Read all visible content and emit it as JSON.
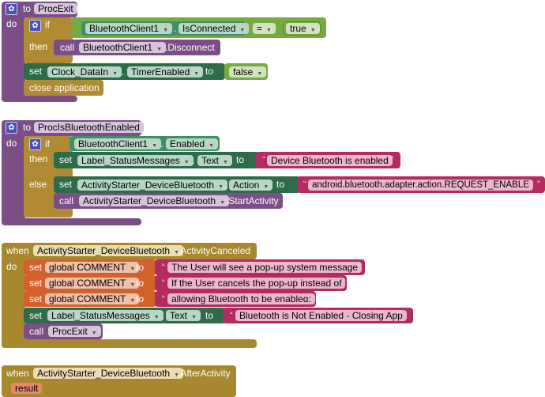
{
  "proc_exit": {
    "to": "to",
    "name": "ProcExit",
    "do": "do",
    "if": "if",
    "then": "then",
    "component": "BluetoothClient1",
    "property": "IsConnected",
    "op": "=",
    "true": "true",
    "call": "call",
    "call_component": "BluetoothClient1",
    "method": ".Disconnect",
    "set": "set",
    "set_component": "Clock_DataIn",
    "set_property": "TimerEnabled",
    "to_kw": "to",
    "false": "false",
    "close": "close application",
    "dot": "."
  },
  "proc_bt": {
    "to": "to",
    "name": "ProcIsBluetoothEnabled",
    "do": "do",
    "if": "if",
    "then": "then",
    "else": "else",
    "component": "BluetoothClient1",
    "property": "Enabled",
    "set": "set",
    "label": "Label_StatusMessages",
    "text_prop": "Text",
    "to_kw": "to",
    "msg": "Device Bluetooth is enabled",
    "starter": "ActivityStarter_DeviceBluetooth",
    "action": "Action",
    "action_value": "android.bluetooth.adapter.action.REQUEST_ENABLE",
    "call": "call",
    "method": ".StartActivity",
    "dot": "."
  },
  "event_cancel": {
    "when": "when",
    "component": "ActivityStarter_DeviceBluetooth",
    "event": ".ActivityCanceled",
    "do": "do",
    "set": "set",
    "var": "global COMMENT",
    "to_kw": "to",
    "comments": [
      "The User will see a pop-up system message",
      "If the User cancels the pop-up instead of",
      "allowing Bluetooth to be enabled:"
    ],
    "label": "Label_StatusMessages",
    "text_prop": "Text",
    "msg": "Bluetooth is Not Enabled - Closing App",
    "call": "call",
    "proc": "ProcExit",
    "dot": "."
  },
  "event_after": {
    "when": "when",
    "component": "ActivityStarter_DeviceBluetooth",
    "event": ".AfterActivity",
    "param": "result"
  },
  "quote": "“",
  "quote_end": "”"
}
